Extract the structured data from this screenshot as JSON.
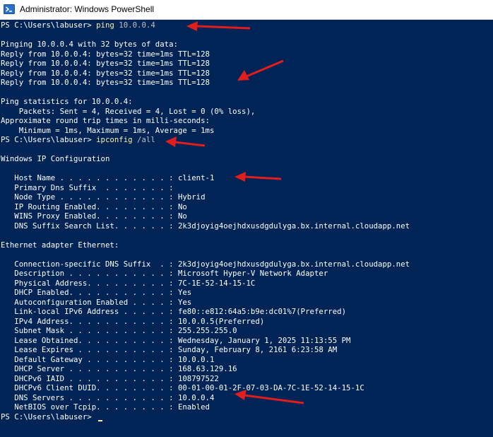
{
  "window": {
    "title": "Administrator: Windows PowerShell",
    "icon": "powershell-icon"
  },
  "console": {
    "lines": [
      {
        "prompt": "PS C:\\Users\\labuser> ",
        "cmd": "ping",
        "args": " 10.0.0.4"
      },
      {
        "text": ""
      },
      {
        "text": "Pinging 10.0.0.4 with 32 bytes of data:"
      },
      {
        "text": "Reply from 10.0.0.4: bytes=32 time=1ms TTL=128"
      },
      {
        "text": "Reply from 10.0.0.4: bytes=32 time=1ms TTL=128"
      },
      {
        "text": "Reply from 10.0.0.4: bytes=32 time=1ms TTL=128"
      },
      {
        "text": "Reply from 10.0.0.4: bytes=32 time=1ms TTL=128"
      },
      {
        "text": ""
      },
      {
        "text": "Ping statistics for 10.0.0.4:"
      },
      {
        "text": "    Packets: Sent = 4, Received = 4, Lost = 0 (0% loss),"
      },
      {
        "text": "Approximate round trip times in milli-seconds:"
      },
      {
        "text": "    Minimum = 1ms, Maximum = 1ms, Average = 1ms"
      },
      {
        "prompt": "PS C:\\Users\\labuser> ",
        "cmd": "ipconfig",
        "args": " /all"
      },
      {
        "text": ""
      },
      {
        "text": "Windows IP Configuration"
      },
      {
        "text": ""
      },
      {
        "text": "   Host Name . . . . . . . . . . . . : client-1"
      },
      {
        "text": "   Primary Dns Suffix  . . . . . . . :"
      },
      {
        "text": "   Node Type . . . . . . . . . . . . : Hybrid"
      },
      {
        "text": "   IP Routing Enabled. . . . . . . . : No"
      },
      {
        "text": "   WINS Proxy Enabled. . . . . . . . : No"
      },
      {
        "text": "   DNS Suffix Search List. . . . . . : 2k3djoyig4oejhdxusdgdulyga.bx.internal.cloudapp.net"
      },
      {
        "text": ""
      },
      {
        "text": "Ethernet adapter Ethernet:"
      },
      {
        "text": ""
      },
      {
        "text": "   Connection-specific DNS Suffix  . : 2k3djoyig4oejhdxusdgdulyga.bx.internal.cloudapp.net"
      },
      {
        "text": "   Description . . . . . . . . . . . : Microsoft Hyper-V Network Adapter"
      },
      {
        "text": "   Physical Address. . . . . . . . . : 7C-1E-52-14-15-1C"
      },
      {
        "text": "   DHCP Enabled. . . . . . . . . . . : Yes"
      },
      {
        "text": "   Autoconfiguration Enabled . . . . : Yes"
      },
      {
        "text": "   Link-local IPv6 Address . . . . . : fe80::e812:64a5:b9e:dc01%7(Preferred)"
      },
      {
        "text": "   IPv4 Address. . . . . . . . . . . : 10.0.0.5(Preferred)"
      },
      {
        "text": "   Subnet Mask . . . . . . . . . . . : 255.255.255.0"
      },
      {
        "text": "   Lease Obtained. . . . . . . . . . : Wednesday, January 1, 2025 11:13:55 PM"
      },
      {
        "text": "   Lease Expires . . . . . . . . . . : Sunday, February 8, 2161 6:23:58 AM"
      },
      {
        "text": "   Default Gateway . . . . . . . . . : 10.0.0.1"
      },
      {
        "text": "   DHCP Server . . . . . . . . . . . : 168.63.129.16"
      },
      {
        "text": "   DHCPv6 IAID . . . . . . . . . . . : 108797522"
      },
      {
        "text": "   DHCPv6 Client DUID. . . . . . . . : 00-01-00-01-2F-07-03-DA-7C-1E-52-14-15-1C"
      },
      {
        "text": "   DNS Servers . . . . . . . . . . . : 10.0.0.4"
      },
      {
        "text": "   NetBIOS over Tcpip. . . . . . . . : Enabled"
      },
      {
        "prompt": "PS C:\\Users\\labuser> ",
        "cursor": true
      }
    ]
  },
  "colors": {
    "background": "#012456",
    "text": "#ffffff",
    "command": "#f9f1a5",
    "annotation_arrow": "#e01e1e"
  },
  "annotations": [
    {
      "icon": "red-arrow-icon",
      "points_to": "ping 10.0.0.4"
    },
    {
      "icon": "red-arrow-icon",
      "points_to": "Reply from 10.0.0.4"
    },
    {
      "icon": "red-arrow-icon",
      "points_to": "ipconfig /all"
    },
    {
      "icon": "red-arrow-icon",
      "points_to": "client-1"
    },
    {
      "icon": "red-arrow-icon",
      "points_to": "DNS Servers 10.0.0.4"
    }
  ]
}
